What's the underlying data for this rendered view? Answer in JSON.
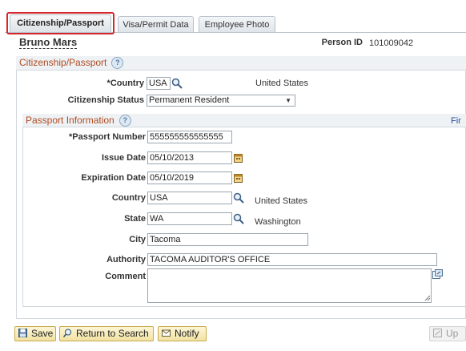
{
  "tabs": [
    {
      "label": "Citizenship/Passport"
    },
    {
      "label": "Visa/Permit Data"
    },
    {
      "label": "Employee Photo"
    }
  ],
  "employee": {
    "name": "Bruno Mars",
    "person_id_label": "Person ID",
    "person_id": "101009042"
  },
  "citizenship": {
    "section_title": "Citizenship/Passport",
    "country_label": "*Country",
    "country_value": "USA",
    "country_desc": "United States",
    "status_label": "Citizenship Status",
    "status_value": "Permanent Resident"
  },
  "passport": {
    "section_title": "Passport Information",
    "find_link": "Fir",
    "number_label": "*Passport Number",
    "number_value": "555555555555555",
    "issue_label": "Issue Date",
    "issue_value": "05/10/2013",
    "expiration_label": "Expiration Date",
    "expiration_value": "05/10/2019",
    "country_label": "Country",
    "country_value": "USA",
    "country_desc": "United States",
    "state_label": "State",
    "state_value": "WA",
    "state_desc": "Washington",
    "city_label": "City",
    "city_value": "Tacoma",
    "authority_label": "Authority",
    "authority_value": "TACOMA AUDITOR'S OFFICE",
    "comment_label": "Comment",
    "comment_value": ""
  },
  "toolbar": {
    "save_label": "Save",
    "return_label": "Return to Search",
    "notify_label": "Notify",
    "update_label": "Up"
  },
  "help_glyph": "?",
  "icons": [
    "search-icon",
    "calendar-icon",
    "help-icon",
    "expand-icon",
    "save-icon",
    "return-icon",
    "notify-icon",
    "update-icon"
  ],
  "colors": {
    "section_title": "#b04a21",
    "highlight": "#d6252b",
    "button": "#f1e2a2"
  }
}
